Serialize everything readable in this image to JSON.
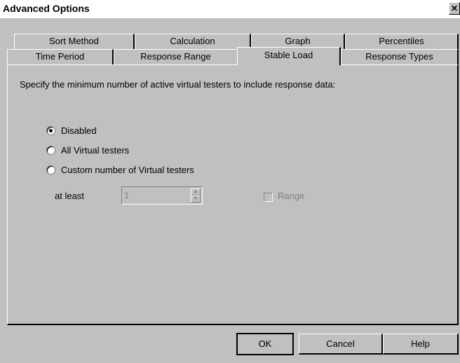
{
  "window": {
    "title": "Advanced Options",
    "close_glyph": "✕"
  },
  "tabs": {
    "row1": [
      "Sort Method",
      "Calculation",
      "Graph",
      "Percentiles"
    ],
    "row2": [
      "Time Period",
      "Response Range",
      "Stable Load",
      "Response Types"
    ],
    "active": "Stable Load"
  },
  "content": {
    "description": "Specify the minimum number of active virtual testers to include response data:",
    "options": [
      {
        "label": "Disabled",
        "checked": true
      },
      {
        "label": "All Virtual testers",
        "checked": false
      },
      {
        "label": "Custom number of Virtual testers",
        "checked": false
      }
    ],
    "at_least_label": "at least",
    "at_least_value": "1",
    "range_label": "Range",
    "range_checked": false
  },
  "buttons": {
    "ok": "OK",
    "cancel": "Cancel",
    "help": "Help"
  }
}
